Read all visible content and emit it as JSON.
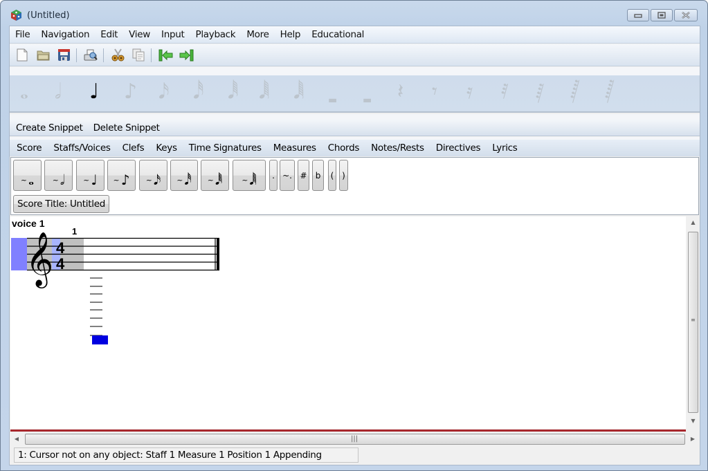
{
  "window": {
    "title": "(Untitled)",
    "controls": [
      "minimize",
      "maximize",
      "close"
    ]
  },
  "menubar": {
    "items": [
      "File",
      "Navigation",
      "Edit",
      "View",
      "Input",
      "Playback",
      "More",
      "Help",
      "Educational"
    ]
  },
  "toolbar": {
    "buttons": [
      {
        "name": "new-file-icon",
        "label": "New"
      },
      {
        "name": "open-folder-icon",
        "label": "Open"
      },
      {
        "name": "save-icon",
        "label": "Save"
      },
      {
        "name": "print-preview-icon",
        "label": "Print Preview"
      },
      {
        "name": "cut-icon",
        "label": "Cut"
      },
      {
        "name": "copy-icon",
        "label": "Copy"
      },
      {
        "name": "previous-movement-icon",
        "label": "Previous"
      },
      {
        "name": "next-movement-icon",
        "label": "Next"
      }
    ]
  },
  "duration_palette": {
    "items": [
      {
        "name": "whole-note",
        "glyph": "𝅝",
        "active": false
      },
      {
        "name": "half-note",
        "glyph": "𝅗𝅥",
        "active": false
      },
      {
        "name": "quarter-note",
        "glyph": "♩",
        "active": true
      },
      {
        "name": "eighth-note",
        "glyph": "♪",
        "active": false
      },
      {
        "name": "sixteenth-note",
        "glyph": "𝅘𝅥𝅯",
        "active": false
      },
      {
        "name": "thirty-second-note",
        "glyph": "𝅘𝅥𝅰",
        "active": false
      },
      {
        "name": "sixty-fourth-note",
        "glyph": "𝅘𝅥𝅱",
        "active": false
      },
      {
        "name": "128th-note",
        "glyph": "𝅘𝅥𝅲",
        "active": false
      },
      {
        "name": "256th-note",
        "glyph": "𝅘𝅥𝅲",
        "active": false
      },
      {
        "name": "whole-rest",
        "glyph": "▬",
        "active": false
      },
      {
        "name": "half-rest",
        "glyph": "▬",
        "active": false
      },
      {
        "name": "quarter-rest",
        "glyph": "𝄽",
        "active": false
      },
      {
        "name": "eighth-rest",
        "glyph": "𝄾",
        "active": false
      },
      {
        "name": "sixteenth-rest",
        "glyph": "𝄿",
        "active": false
      },
      {
        "name": "thirty-second-rest",
        "glyph": "𝅀",
        "active": false
      },
      {
        "name": "sixty-fourth-rest",
        "glyph": "𝅁",
        "active": false
      },
      {
        "name": "128th-rest",
        "glyph": "𝅂",
        "active": false
      },
      {
        "name": "256th-rest",
        "glyph": "𝅂",
        "active": false
      }
    ]
  },
  "snippets": {
    "create_label": "Create Snippet",
    "delete_label": "Delete Snippet"
  },
  "categories": {
    "items": [
      "Score",
      "Staffs/Voices",
      "Clefs",
      "Keys",
      "Time Signatures",
      "Measures",
      "Chords",
      "Notes/Rests",
      "Directives",
      "Lyrics"
    ]
  },
  "note_buttons": {
    "tilde": "~",
    "items": [
      {
        "name": "insert-whole-note",
        "glyph": "𝅝"
      },
      {
        "name": "insert-half-note",
        "glyph": "𝅗𝅥"
      },
      {
        "name": "insert-quarter-note",
        "glyph": "♩"
      },
      {
        "name": "insert-eighth-note",
        "glyph": "♪"
      },
      {
        "name": "insert-sixteenth-note",
        "glyph": "𝅘𝅥𝅯"
      },
      {
        "name": "insert-thirty-second-note",
        "glyph": "𝅘𝅥𝅰"
      },
      {
        "name": "insert-sixty-fourth-note",
        "glyph": "𝅘𝅥𝅱"
      },
      {
        "name": "insert-128th-note",
        "glyph": "𝅘𝅥𝅲"
      }
    ],
    "modifiers": [
      {
        "name": "dot-button",
        "label": "."
      },
      {
        "name": "tie-dot-button",
        "label": "~."
      },
      {
        "name": "sharp-button",
        "label": "#"
      },
      {
        "name": "flat-button",
        "label": "b"
      },
      {
        "name": "open-paren-button",
        "label": "("
      },
      {
        "name": "close-paren-button",
        "label": ")"
      }
    ],
    "score_title_button": "Score Title: Untitled"
  },
  "score": {
    "voice_label": "voice 1",
    "measure_number": "1",
    "clef": "treble",
    "time_signature": {
      "numerator": "4",
      "denominator": "4"
    },
    "clef_glyph": "𝄞"
  },
  "scrollbars": {
    "vertical_position": 0,
    "horizontal_position": 0
  },
  "status": {
    "text": "1: Cursor not on any object:  Staff 1 Measure 1 Position 1 Appending"
  },
  "colors": {
    "selection_blue": "#8080ff",
    "cursor_blue": "#0000e0",
    "measure_gray": "#c0c0c0",
    "redline": "#a8272c"
  }
}
